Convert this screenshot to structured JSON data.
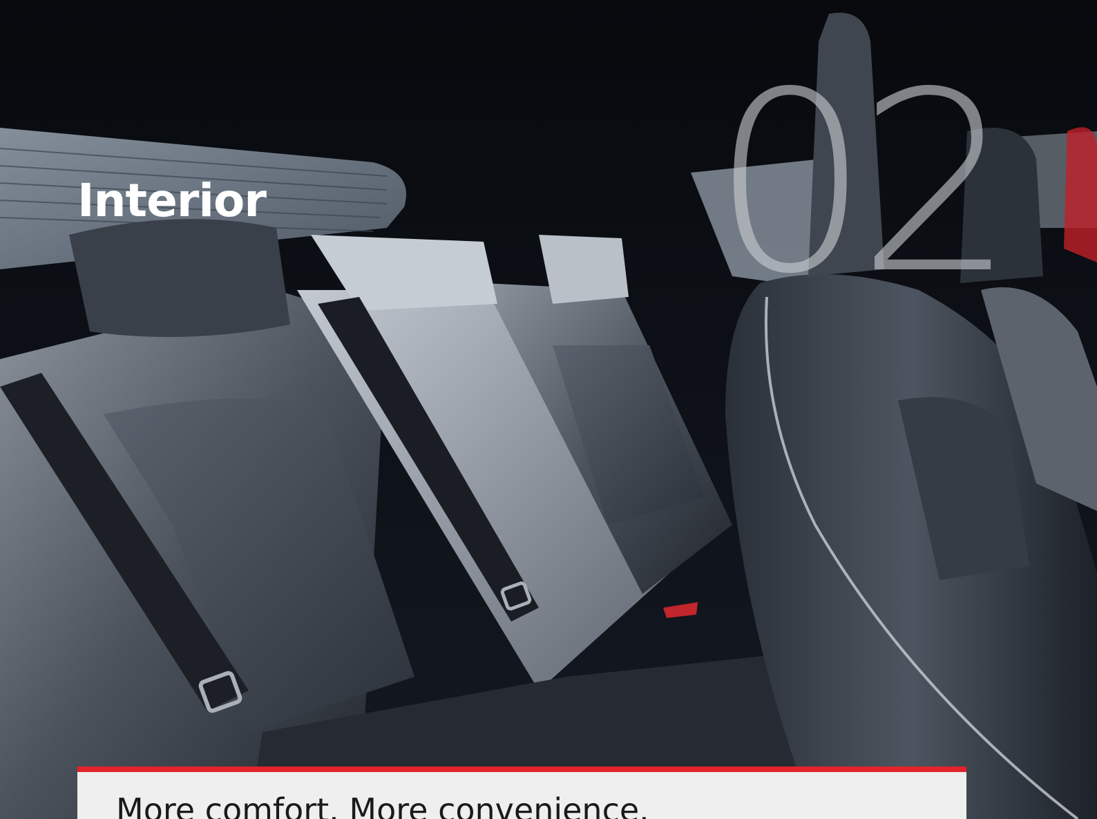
{
  "section": {
    "title": "Interior",
    "number": "02"
  },
  "caption": {
    "text": "More comfort. More convenience."
  },
  "colors": {
    "accent": "#e4232a",
    "caption_bg": "#efefef",
    "title": "#ffffff",
    "number": "#c8cbd0"
  }
}
